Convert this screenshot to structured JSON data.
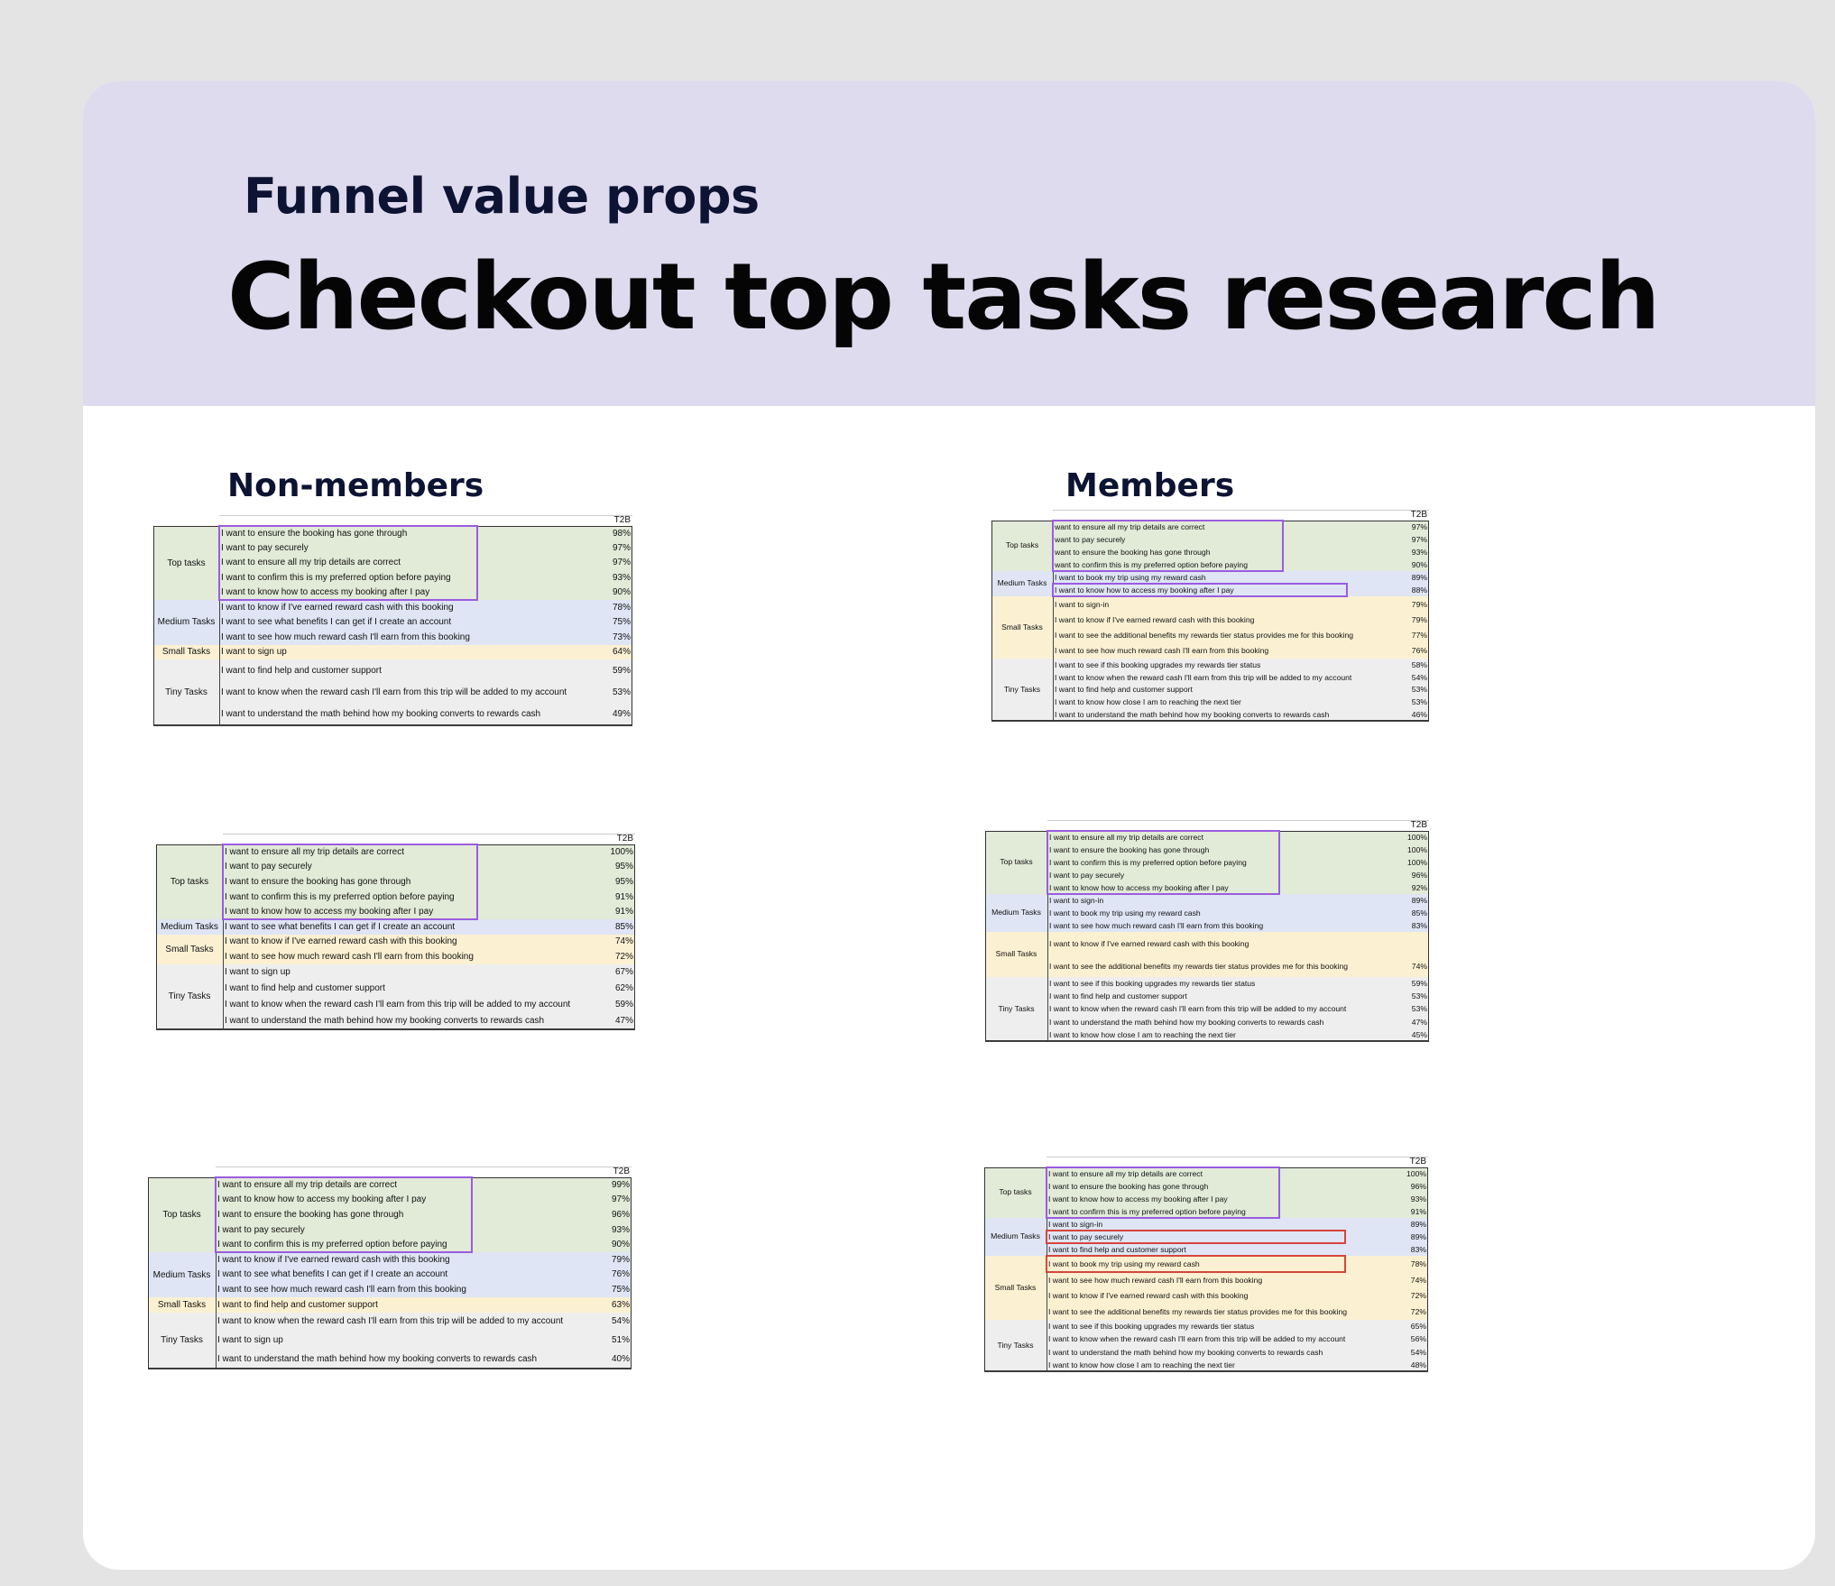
{
  "header": {
    "eyebrow": "Funnel value props",
    "title": "Checkout top tasks research"
  },
  "columns": {
    "non_members": "Non-members",
    "members": "Members"
  },
  "icons": {
    "brand_yellow": "arrow-up-right-icon",
    "brand_red": "square-bracket-icon",
    "brand_navy": "v-logo-icon"
  },
  "colors": {
    "top": "#e2ead8",
    "medium": "#dfe5f4",
    "small": "#fbf1d2",
    "tiny": "#eeeeee",
    "highlight_purple": "#9b5ce0",
    "highlight_red": "#d6453d"
  },
  "tables": [
    {
      "brand": "yellow",
      "audience": "non-members",
      "t2b": "T2B",
      "groups": [
        {
          "label": "Top tasks",
          "type": "top",
          "rows": [
            {
              "text": "I want to ensure the booking has gone through",
              "pct": "98%"
            },
            {
              "text": "I want to pay securely",
              "pct": "97%"
            },
            {
              "text": "I want to ensure all my trip details are correct",
              "pct": "97%"
            },
            {
              "text": "I want to confirm this is my preferred option before paying",
              "pct": "93%"
            },
            {
              "text": "I want to know how to access my booking after I pay",
              "pct": "90%"
            }
          ]
        },
        {
          "label": "Medium Tasks",
          "type": "medium",
          "rows": [
            {
              "text": "I want to know if I've earned reward cash with this booking",
              "pct": "78%"
            },
            {
              "text": "I want to see what benefits I can get if I create an account",
              "pct": "75%"
            },
            {
              "text": "I want to see how much reward cash I'll earn from this booking",
              "pct": "73%"
            }
          ]
        },
        {
          "label": "Small Tasks",
          "type": "small",
          "rows": [
            {
              "text": "I want to sign up",
              "pct": "64%"
            }
          ]
        },
        {
          "label": "Tiny Tasks",
          "type": "tiny",
          "rows": [
            {
              "text": "I want to find help and customer support",
              "pct": "59%"
            },
            {
              "text": "I want to know when the reward cash I'll earn from this trip will be added to my account",
              "pct": "53%"
            },
            {
              "text": "I want to understand the math behind how my booking converts to rewards cash",
              "pct": "49%"
            }
          ]
        }
      ]
    },
    {
      "brand": "red",
      "audience": "non-members",
      "t2b": "T2B",
      "groups": [
        {
          "label": "Top tasks",
          "type": "top",
          "rows": [
            {
              "text": "I want to ensure all my trip details are correct",
              "pct": "100%"
            },
            {
              "text": "I want to pay securely",
              "pct": "95%"
            },
            {
              "text": "I want to ensure the booking has gone through",
              "pct": "95%"
            },
            {
              "text": "I want to confirm this is my preferred option before paying",
              "pct": "91%"
            },
            {
              "text": "I want to know how to access my booking after I pay",
              "pct": "91%"
            }
          ]
        },
        {
          "label": "Medium Tasks",
          "type": "medium",
          "rows": [
            {
              "text": "I want to see what benefits I can get if I create an account",
              "pct": "85%"
            }
          ]
        },
        {
          "label": "Small Tasks",
          "type": "small",
          "rows": [
            {
              "text": "I want to know if I've earned reward cash with this booking",
              "pct": "74%"
            },
            {
              "text": "I want to see how much reward cash I'll earn from this booking",
              "pct": "72%"
            }
          ]
        },
        {
          "label": "Tiny Tasks",
          "type": "tiny",
          "rows": [
            {
              "text": "I want to sign up",
              "pct": "67%"
            },
            {
              "text": "I want to find help and customer support",
              "pct": "62%"
            },
            {
              "text": "I want to know when the reward cash I'll earn from this trip will be added to my account",
              "pct": "59%"
            },
            {
              "text": "I want to understand the math behind how my booking converts to rewards cash",
              "pct": "47%"
            }
          ]
        }
      ]
    },
    {
      "brand": "navy",
      "audience": "non-members",
      "t2b": "T2B",
      "groups": [
        {
          "label": "Top tasks",
          "type": "top",
          "rows": [
            {
              "text": "I want to ensure all my trip details are correct",
              "pct": "99%"
            },
            {
              "text": "I want to know how to access my booking after I pay",
              "pct": "97%"
            },
            {
              "text": "I want to ensure the booking has gone through",
              "pct": "96%"
            },
            {
              "text": "I want to pay securely",
              "pct": "93%"
            },
            {
              "text": "I want to confirm this is my preferred option before paying",
              "pct": "90%"
            }
          ]
        },
        {
          "label": "Medium Tasks",
          "type": "medium",
          "rows": [
            {
              "text": "I want to know if I've earned reward cash with this booking",
              "pct": "79%"
            },
            {
              "text": "I want to see what benefits I can get if I create an account",
              "pct": "76%"
            },
            {
              "text": "I want to see how much reward cash I'll earn from this booking",
              "pct": "75%"
            }
          ]
        },
        {
          "label": "Small Tasks",
          "type": "small",
          "rows": [
            {
              "text": "I want to find help and customer support",
              "pct": "63%"
            }
          ]
        },
        {
          "label": "Tiny Tasks",
          "type": "tiny",
          "rows": [
            {
              "text": "I want to know when the reward cash I'll earn from this trip will be added to my account",
              "pct": "54%"
            },
            {
              "text": "I want to sign up",
              "pct": "51%"
            },
            {
              "text": "I want to understand the math behind how my booking converts to rewards cash",
              "pct": "40%"
            }
          ]
        }
      ]
    },
    {
      "brand": "yellow",
      "audience": "members",
      "t2b": "T2B",
      "groups": [
        {
          "label": "Top tasks",
          "type": "top",
          "rows": [
            {
              "text": "want to ensure all my trip details are correct",
              "pct": "97%"
            },
            {
              "text": "want to pay securely",
              "pct": "97%"
            },
            {
              "text": "want to ensure the booking has gone through",
              "pct": "93%"
            },
            {
              "text": "want to confirm this is my preferred option before paying",
              "pct": "90%"
            }
          ]
        },
        {
          "label": "Medium Tasks",
          "type": "medium",
          "rows": [
            {
              "text": "I want to book my trip using my reward cash",
              "pct": "89%"
            },
            {
              "text": "I want to know how to access my booking after I pay",
              "pct": "88%"
            }
          ]
        },
        {
          "label": "Small Tasks",
          "type": "small",
          "rows": [
            {
              "text": "I want to sign-in",
              "pct": "79%"
            },
            {
              "text": "I want to know if I've earned reward cash with this booking",
              "pct": "79%"
            },
            {
              "text": "I want to see the additional benefits my rewards tier status provides me for this booking",
              "pct": "77%"
            },
            {
              "text": "I want to see how much reward cash I'll earn from this booking",
              "pct": "76%"
            }
          ]
        },
        {
          "label": "Tiny Tasks",
          "type": "tiny",
          "rows": [
            {
              "text": "I want to see if this booking upgrades my rewards tier status",
              "pct": "58%"
            },
            {
              "text": "I want to know when the reward cash I'll earn from this trip will be added to my account",
              "pct": "54%"
            },
            {
              "text": "I want to find help and customer support",
              "pct": "53%"
            },
            {
              "text": "I want to know how close I am to reaching the next tier",
              "pct": "53%"
            },
            {
              "text": "I want to understand the math behind how my booking converts to rewards cash",
              "pct": "46%"
            }
          ]
        }
      ]
    },
    {
      "brand": "red",
      "audience": "members",
      "t2b": "T2B",
      "groups": [
        {
          "label": "Top tasks",
          "type": "top",
          "rows": [
            {
              "text": "I want to ensure all my trip details are correct",
              "pct": "100%"
            },
            {
              "text": "I want to ensure the booking has gone through",
              "pct": "100%"
            },
            {
              "text": "I want to confirm this is my preferred option before paying",
              "pct": "100%"
            },
            {
              "text": "I want to pay securely",
              "pct": "96%"
            },
            {
              "text": "I want to know how to access my booking after I pay",
              "pct": "92%"
            }
          ]
        },
        {
          "label": "Medium Tasks",
          "type": "medium",
          "rows": [
            {
              "text": "I want to sign-in",
              "pct": "89%"
            },
            {
              "text": "I want to book my trip using my reward cash",
              "pct": "85%"
            },
            {
              "text": "I want to see how much reward cash I'll earn from this booking",
              "pct": "83%"
            }
          ]
        },
        {
          "label": "Small Tasks",
          "type": "small",
          "rows": [
            {
              "text": "I want to know if I've earned reward cash with this booking",
              "pct": ""
            },
            {
              "text": "I want to see the additional benefits my rewards tier status provides me for this booking",
              "pct": "74%"
            }
          ]
        },
        {
          "label": "Tiny Tasks",
          "type": "tiny",
          "rows": [
            {
              "text": "I want to see if this booking upgrades my rewards tier status",
              "pct": "59%"
            },
            {
              "text": "I want to find help and customer support",
              "pct": "53%"
            },
            {
              "text": "I want to know when the reward cash I'll earn from this trip will be added to my account",
              "pct": "53%"
            },
            {
              "text": "I want to understand the math behind how my booking converts to rewards cash",
              "pct": "47%"
            },
            {
              "text": "I want to know how close I am to reaching the next tier",
              "pct": "45%"
            }
          ]
        }
      ]
    },
    {
      "brand": "navy",
      "audience": "members",
      "t2b": "T2B",
      "groups": [
        {
          "label": "Top tasks",
          "type": "top",
          "rows": [
            {
              "text": "I want to ensure all my trip details are correct",
              "pct": "100%"
            },
            {
              "text": "I want to ensure the booking has gone through",
              "pct": "96%"
            },
            {
              "text": "I want to know how to access my booking after I pay",
              "pct": "93%"
            },
            {
              "text": "I want to confirm this is my preferred option before paying",
              "pct": "91%"
            }
          ]
        },
        {
          "label": "Medium Tasks",
          "type": "medium",
          "rows": [
            {
              "text": "I want to sign-in",
              "pct": "89%"
            },
            {
              "text": "I want to pay securely",
              "pct": "89%"
            },
            {
              "text": "I want to find help and customer support",
              "pct": "83%"
            }
          ]
        },
        {
          "label": "Small Tasks",
          "type": "small",
          "rows": [
            {
              "text": "I want to book my trip using my reward cash",
              "pct": "78%"
            },
            {
              "text": "I want to see how much reward cash I'll earn from this booking",
              "pct": "74%"
            },
            {
              "text": "I want to know if I've earned reward cash with this booking",
              "pct": "72%"
            },
            {
              "text": "I want to see the additional benefits my rewards tier status provides me for this booking",
              "pct": "72%"
            }
          ]
        },
        {
          "label": "Tiny Tasks",
          "type": "tiny",
          "rows": [
            {
              "text": "I want to see if this booking upgrades my rewards tier status",
              "pct": "65%"
            },
            {
              "text": "I want to know when the reward cash I'll earn from this trip will be added to my account",
              "pct": "56%"
            },
            {
              "text": "I want to understand the math behind how my booking converts to rewards cash",
              "pct": "54%"
            },
            {
              "text": "I want to know how close I am to reaching the next tier",
              "pct": "48%"
            }
          ]
        }
      ]
    }
  ]
}
